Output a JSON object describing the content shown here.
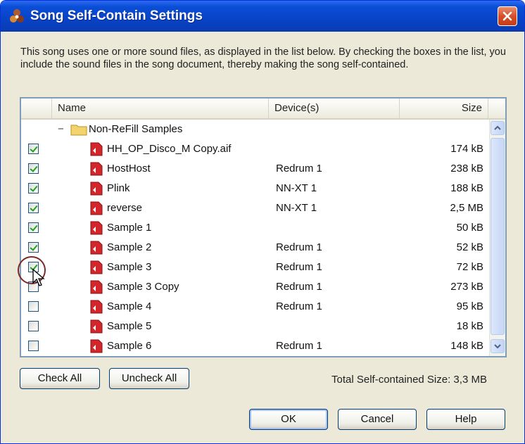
{
  "window": {
    "title": "Song Self-Contain Settings"
  },
  "description": "This song uses one or more sound files, as displayed in the list below. By checking the boxes in the list, you include the sound files in the song document, thereby making the song self-contained.",
  "list": {
    "columns": {
      "name": "Name",
      "device": "Device(s)",
      "size": "Size"
    },
    "group": {
      "expander": "−",
      "label": "Non-ReFill Samples"
    },
    "items": [
      {
        "checked": true,
        "name": "HH_OP_Disco_M Copy.aif",
        "device": "",
        "size": "174 kB"
      },
      {
        "checked": true,
        "name": "HostHost",
        "device": "Redrum 1",
        "size": "238 kB"
      },
      {
        "checked": true,
        "name": "Plink",
        "device": "NN-XT 1",
        "size": "188 kB"
      },
      {
        "checked": true,
        "name": "reverse",
        "device": "NN-XT 1",
        "size": "2,5 MB"
      },
      {
        "checked": true,
        "name": "Sample 1",
        "device": "",
        "size": "50 kB"
      },
      {
        "checked": true,
        "name": "Sample 2",
        "device": "Redrum 1",
        "size": "52 kB"
      },
      {
        "checked": true,
        "name": "Sample 3",
        "device": "Redrum 1",
        "size": "72 kB"
      },
      {
        "checked": false,
        "name": "Sample 3 Copy",
        "device": "Redrum 1",
        "size": "273 kB"
      },
      {
        "checked": false,
        "name": "Sample 4",
        "device": "Redrum 1",
        "size": "95 kB"
      },
      {
        "checked": false,
        "name": "Sample 5",
        "device": "",
        "size": "18 kB"
      },
      {
        "checked": false,
        "name": "Sample 6",
        "device": "Redrum 1",
        "size": "148 kB"
      }
    ]
  },
  "buttons": {
    "check_all": "Check All",
    "uncheck_all": "Uncheck All",
    "ok": "OK",
    "cancel": "Cancel",
    "help": "Help"
  },
  "total_text": "Total Self-contained Size: 3,3 MB",
  "colors": {
    "titlebar": "#0a4ed6",
    "window_bg": "#ece9d8",
    "close": "#d74f2a",
    "file_icon": "#d3262b",
    "folder_icon": "#f3d36e"
  },
  "icons": {
    "app": "reason-app-icon",
    "close": "close-icon",
    "folder": "folder-icon",
    "file": "sample-file-icon",
    "cursor": "mouse-pointer-icon"
  }
}
